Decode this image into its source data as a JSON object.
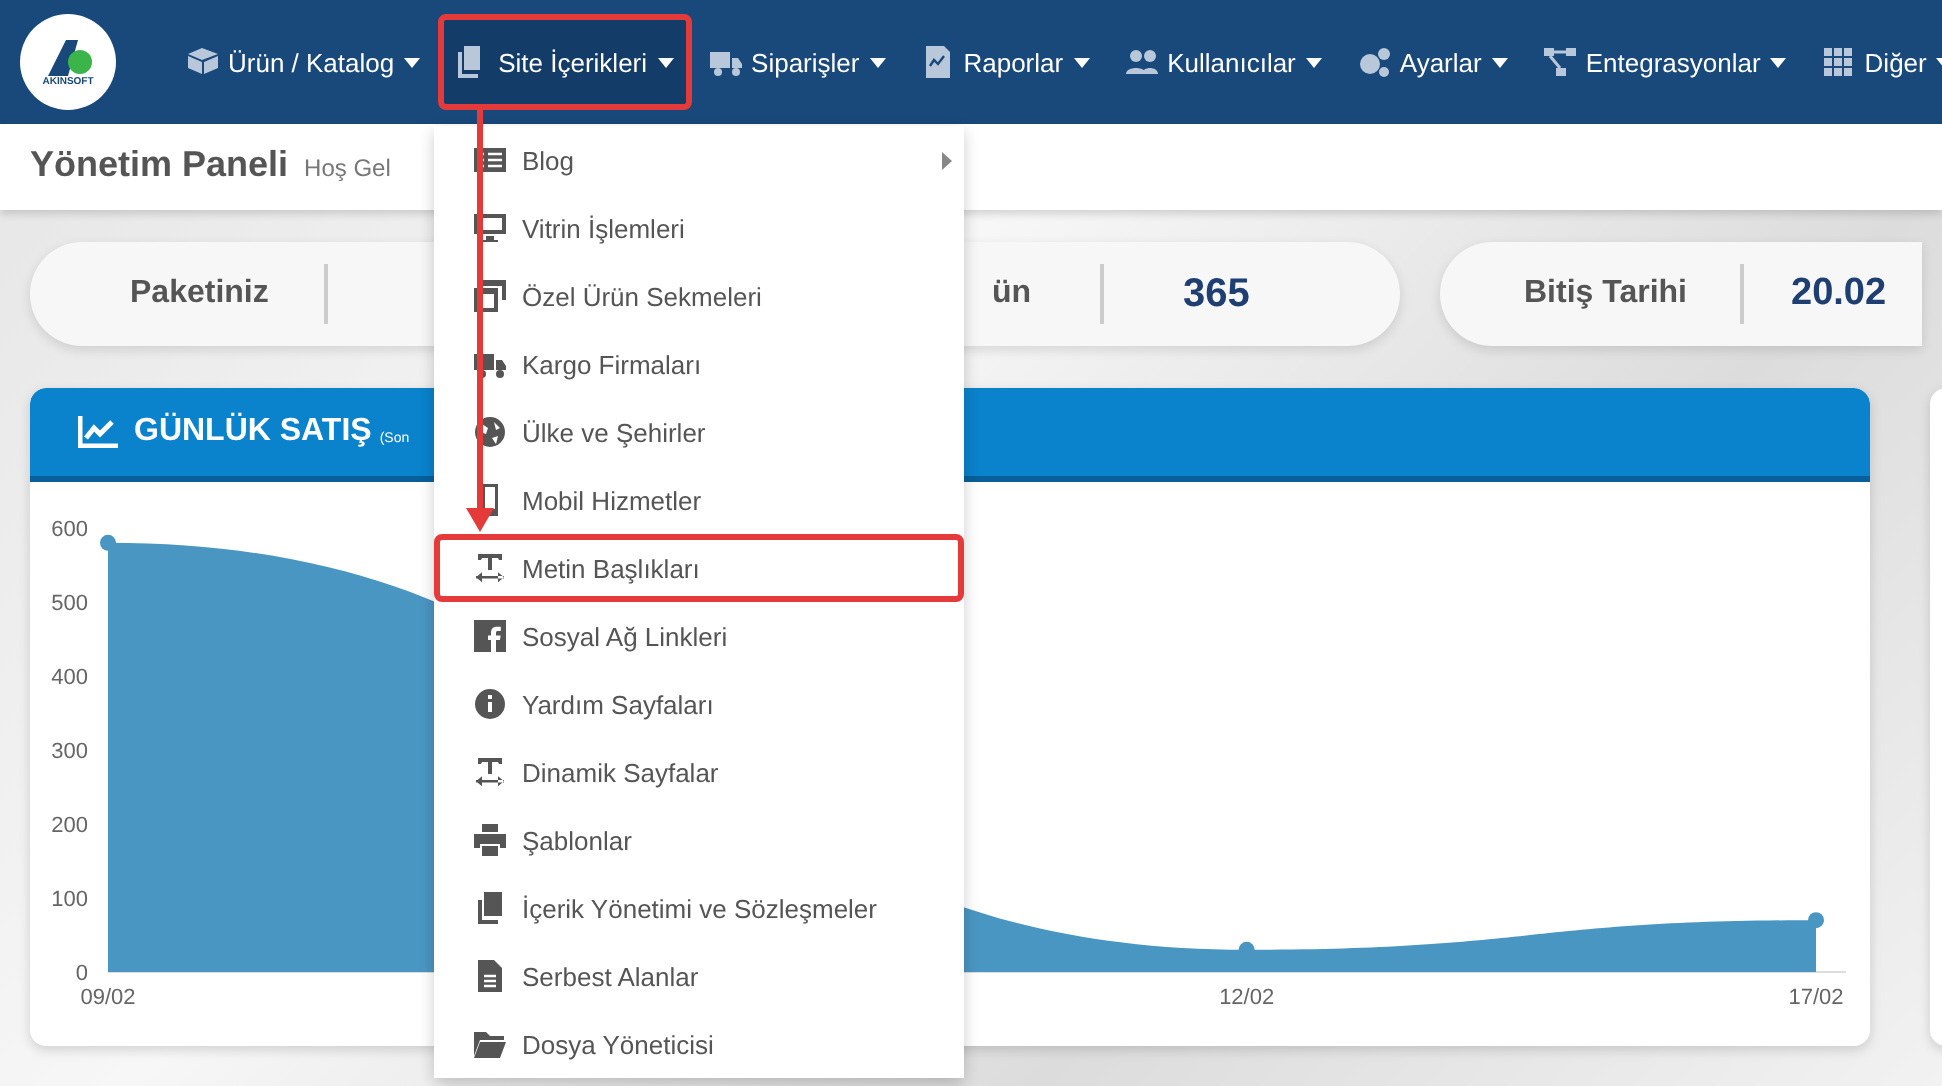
{
  "nav": {
    "logo_text": "AKINSOFT",
    "items": [
      {
        "label": "Ürün / Katalog",
        "selected": false,
        "highlighted": false
      },
      {
        "label": "Site İçerikleri",
        "selected": true,
        "highlighted": true
      },
      {
        "label": "Siparişler",
        "selected": false,
        "highlighted": false
      },
      {
        "label": "Raporlar",
        "selected": false,
        "highlighted": false
      },
      {
        "label": "Kullanıcılar",
        "selected": false,
        "highlighted": false
      },
      {
        "label": "Ayarlar",
        "selected": false,
        "highlighted": false
      },
      {
        "label": "Entegrasyonlar",
        "selected": false,
        "highlighted": false
      },
      {
        "label": "Diğer",
        "selected": false,
        "highlighted": false
      }
    ]
  },
  "page_header": {
    "title": "Yönetim Paneli",
    "subtitle": "Hoş Gel"
  },
  "stats": [
    {
      "label": "Paketiniz"
    },
    {
      "label": "ün",
      "value": "365"
    },
    {
      "label": "Bitiş Tarihi",
      "value": "20.02"
    }
  ],
  "sales_card": {
    "title": "GÜNLÜK SATIŞ",
    "note": "(Son",
    "chart_data": {
      "type": "area",
      "categories": [
        "09/02",
        null,
        "12/02",
        "17/02"
      ],
      "ylim": [
        0,
        600
      ],
      "yticks": [
        0,
        100,
        200,
        300,
        400,
        500,
        600
      ],
      "series": [
        {
          "color": "#4a96c3",
          "values": [
            580,
            null,
            30,
            70
          ]
        }
      ]
    }
  },
  "dropdown": {
    "items": [
      {
        "label": "Blog",
        "has_submenu": true,
        "highlighted": false
      },
      {
        "label": "Vitrin İşlemleri",
        "has_submenu": false,
        "highlighted": false
      },
      {
        "label": "Özel Ürün Sekmeleri",
        "has_submenu": false,
        "highlighted": false
      },
      {
        "label": "Kargo Firmaları",
        "has_submenu": false,
        "highlighted": false
      },
      {
        "label": "Ülke ve Şehirler",
        "has_submenu": false,
        "highlighted": false
      },
      {
        "label": "Mobil Hizmetler",
        "has_submenu": false,
        "highlighted": false
      },
      {
        "label": "Metin Başlıkları",
        "has_submenu": false,
        "highlighted": true
      },
      {
        "label": "Sosyal Ağ Linkleri",
        "has_submenu": false,
        "highlighted": false
      },
      {
        "label": "Yardım Sayfaları",
        "has_submenu": false,
        "highlighted": false
      },
      {
        "label": "Dinamik Sayfalar",
        "has_submenu": false,
        "highlighted": false
      },
      {
        "label": "Şablonlar",
        "has_submenu": false,
        "highlighted": false
      },
      {
        "label": "İçerik Yönetimi ve Sözleşmeler",
        "has_submenu": false,
        "highlighted": false
      },
      {
        "label": "Serbest Alanlar",
        "has_submenu": false,
        "highlighted": false
      },
      {
        "label": "Dosya Yöneticisi",
        "has_submenu": false,
        "highlighted": false
      }
    ]
  }
}
